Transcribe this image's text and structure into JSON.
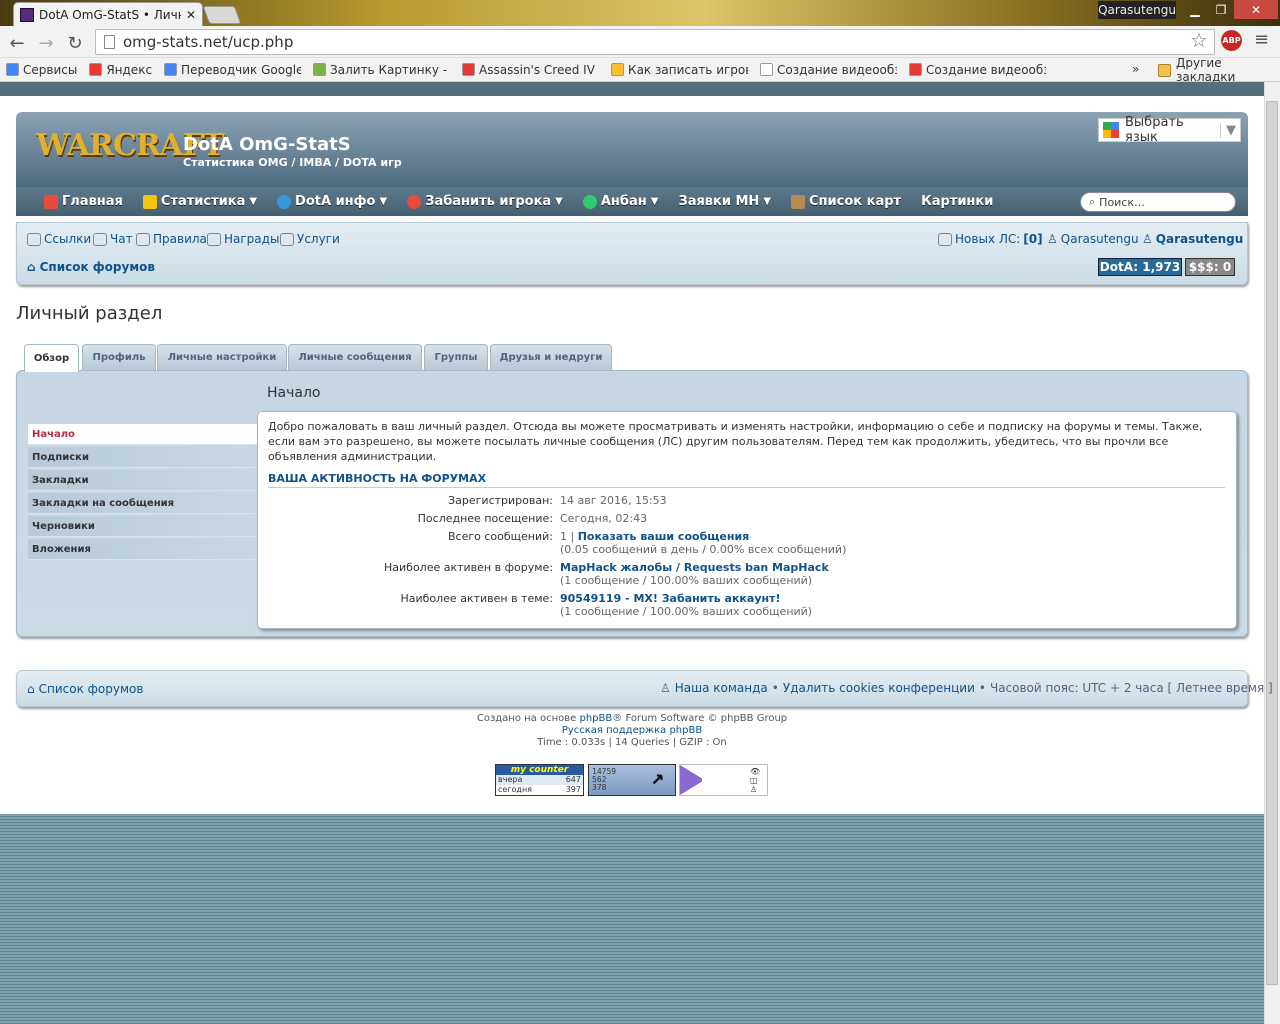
{
  "browser": {
    "tab_title": "DotA OmG-StatS • Личный",
    "window_user": "Qarasutengu",
    "url": "omg-stats.net/ucp.php",
    "bookmarks": [
      {
        "label": "Сервисы",
        "color": "#4285f4"
      },
      {
        "label": "Яндекс",
        "color": "#e53935"
      },
      {
        "label": "Переводчик Google",
        "color": "#4285f4"
      },
      {
        "label": "Залить Картинку - За",
        "color": "#7cb342"
      },
      {
        "label": "Assassin's Creed IV Bl",
        "color": "#e53935"
      },
      {
        "label": "Как записать игрово",
        "color": "#fbc02d"
      },
      {
        "label": "Создание видеообзо",
        "color": "#ffffff"
      },
      {
        "label": "Создание видеообзо",
        "color": "#e53935"
      }
    ],
    "bookmarks_more": "»",
    "other_bookmarks": "Другие закладки"
  },
  "header": {
    "logo_text": "WARCRAFT",
    "site_name": "DotA OmG-StatS",
    "site_desc": "Статистика OMG / IMBA / DOTA игр",
    "language_button": "Выбрать язык"
  },
  "nav": {
    "items": [
      {
        "label": "Главная",
        "dropdown": false,
        "icon": "home-icon",
        "color": "#e74c3c"
      },
      {
        "label": "Статистика",
        "dropdown": true,
        "icon": "chart-icon",
        "color": "#f1c40f"
      },
      {
        "label": "DotA инфо",
        "dropdown": true,
        "icon": "help-icon",
        "color": "#3498db"
      },
      {
        "label": "Забанить игрока",
        "dropdown": true,
        "icon": "ban-icon",
        "color": "#e74c3c"
      },
      {
        "label": "Анбан",
        "dropdown": true,
        "icon": "check-icon",
        "color": "#2ecc71"
      },
      {
        "label": "Заявки МН",
        "dropdown": true,
        "icon": "",
        "color": ""
      },
      {
        "label": "Список карт",
        "dropdown": false,
        "icon": "map-icon",
        "color": "#b58b52"
      },
      {
        "label": "Картинки",
        "dropdown": false,
        "icon": "",
        "color": ""
      }
    ],
    "search_placeholder": "Поиск…"
  },
  "subbar": {
    "links": [
      "Ссылки",
      "Чат",
      "Правила",
      "Награды",
      "Услуги"
    ],
    "new_pm_label": "Новых ЛС:",
    "new_pm_count": "[0]",
    "user_link": "Qarasutengu",
    "user_bold": "Qarasutengu",
    "forum_index": "Список форумов",
    "dota_badge": "DotA: 1,973",
    "money_badge": "$$$: 0"
  },
  "page_title": "Личный раздел",
  "tabs": [
    "Обзор",
    "Профиль",
    "Личные настройки",
    "Личные сообщения",
    "Группы",
    "Друзья и недруги"
  ],
  "sidebar": [
    "Начало",
    "Подписки",
    "Закладки",
    "Закладки на сообщения",
    "Черновики",
    "Вложения"
  ],
  "main": {
    "heading": "Начало",
    "welcome": "Добро пожаловать в ваш личный раздел. Отсюда вы можете просматривать и изменять настройки, информацию о себе и подписку на форумы и темы. Также, если вам это разрешено, вы можете посылать личные сообщения (ЛС) другим пользователям. Перед тем как продолжить, убедитесь, что вы прочли все объявления администрации.",
    "activity_title": "ВАША АКТИВНОСТЬ НА ФОРУМАХ",
    "registered_label": "Зарегистрирован:",
    "registered_value": "14 авг 2016, 15:53",
    "last_visit_label": "Последнее посещение:",
    "last_visit_value": "Сегодня, 02:43",
    "posts_label": "Всего сообщений:",
    "posts_count": "1 |",
    "posts_link": "Показать ваши сообщения",
    "posts_detail": "(0.05 сообщений в день / 0.00% всех сообщений)",
    "active_forum_label": "Наиболее активен в форуме:",
    "active_forum_link": "MapHack жалобы / Requests ban MapHack",
    "active_forum_detail": "(1 сообщение / 100.00% ваших сообщений)",
    "active_topic_label": "Наиболее активен в теме:",
    "active_topic_link": "90549119 - MX! Забанить аккаунт!",
    "active_topic_detail": "(1 сообщение / 100.00% ваших сообщений)"
  },
  "footer": {
    "forum_index": "Список форумов",
    "team": "Наша команда",
    "sep": "•",
    "delete_cookies": "Удалить cookies конференции",
    "timezone": "Часовой пояс: UTC + 2 часа [ Летнее время ]",
    "created_pre": "Создано на основе",
    "created_link": "phpBB",
    "created_post": "® Forum Software © phpBB Group",
    "support": "Русская поддержка phpBB",
    "stats": "Time : 0.033s | 14 Queries | GZIP : On"
  },
  "counters": {
    "mycounter_title": "my counter",
    "yesterday_label": "вчера",
    "yesterday_value": "647",
    "today_label": "сегодня",
    "today_value": "397",
    "c2_line1": "14759",
    "c2_line2": "562",
    "c2_line3": "378"
  }
}
